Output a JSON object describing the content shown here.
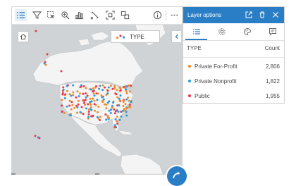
{
  "toolbar": {
    "buttons": [
      {
        "name": "layer-list-icon",
        "active": true
      },
      {
        "name": "filter-icon"
      },
      {
        "name": "selection-icon"
      },
      {
        "name": "zoom-icon"
      },
      {
        "name": "chart-icon"
      },
      {
        "name": "lasso-icon"
      },
      {
        "name": "extent-icon"
      },
      {
        "name": "spatial-analysis-icon"
      },
      {
        "name": "info-icon"
      },
      {
        "name": "more-icon"
      }
    ]
  },
  "map": {
    "legend_label": "TYPE",
    "land_color": "#f4f4f4",
    "water_color": "#cfd3d5"
  },
  "panel": {
    "title": "Layer options",
    "header_color": "#2a7ec5",
    "tabs": [
      "legend-tab",
      "style-tab",
      "appearance-tab",
      "popup-tab"
    ],
    "table": {
      "field_label": "TYPE",
      "count_label": "Count",
      "rows": [
        {
          "label": "Private For-Profit",
          "count": "2,806",
          "color": "#f08a2c"
        },
        {
          "label": "Private Nonprofit",
          "count": "1,822",
          "color": "#2b9ad4"
        },
        {
          "label": "Public",
          "count": "1,955",
          "color": "#e8374f"
        }
      ]
    }
  }
}
